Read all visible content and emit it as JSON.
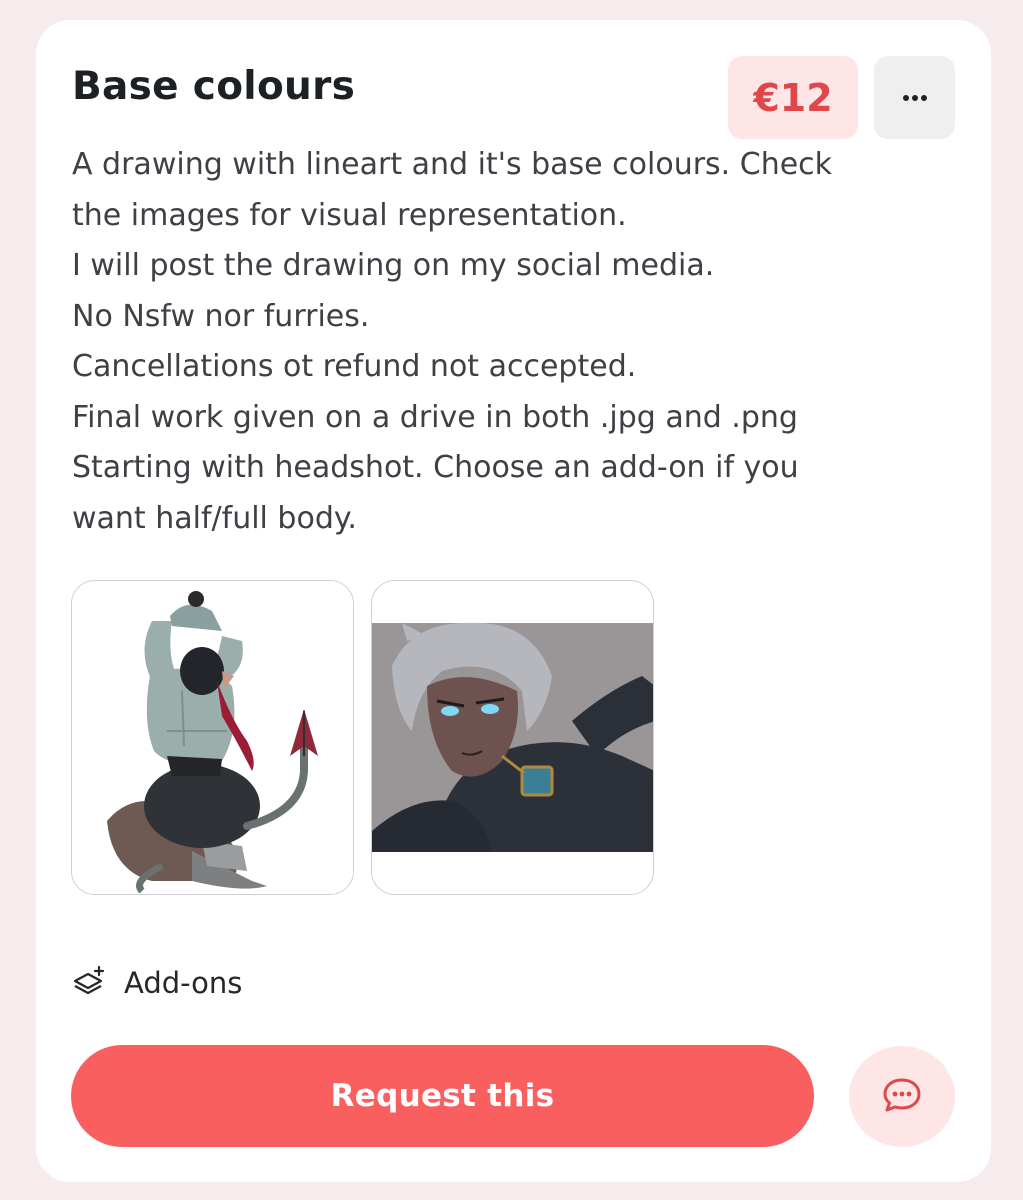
{
  "offer": {
    "title": "Base colours",
    "price": "€12",
    "more_icon": "ellipsis-icon",
    "description_lines": [
      "A drawing with lineart and it's base colours. Check",
      "the images for visual representation.",
      "I will post the drawing on my social media.",
      "No Nsfw nor furries.",
      "Cancellations ot refund not accepted.",
      "Final work given on a drive in both .jpg and .png",
      "Starting with headshot. Choose an add-on if you",
      "want half/full body."
    ]
  },
  "gallery": {
    "images": [
      "sample-artwork-1",
      "sample-artwork-2"
    ]
  },
  "addons": {
    "label": "Add-ons",
    "icon": "layers-plus-icon"
  },
  "actions": {
    "request_label": "Request this",
    "chat_icon": "chat-bubble-icon"
  },
  "colors": {
    "accent": "#fa5f5f",
    "price_text": "#e0474a",
    "badge_bg": "#fde6e5",
    "page_bg": "#f7eced"
  }
}
